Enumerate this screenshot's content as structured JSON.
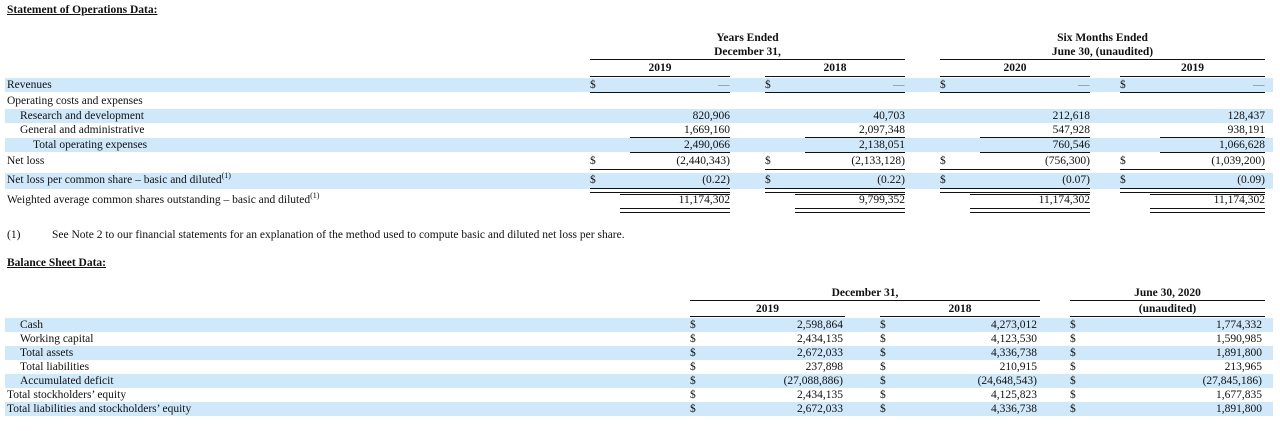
{
  "ops": {
    "title": "Statement of Operations Data:",
    "group1": "Years Ended\nDecember 31,",
    "group2": "Six Months Ended\nJune 30, (unaudited)",
    "cols": [
      "2019",
      "2018",
      "2020",
      "2019"
    ],
    "currency": "$",
    "dash": "—",
    "rows": [
      {
        "label": "Revenues",
        "indent": 0,
        "dollar": true,
        "values": [
          "—",
          "—",
          "—",
          "—"
        ],
        "band": true
      },
      {
        "label": "Operating costs and expenses",
        "indent": 0,
        "dollar": false,
        "values": [
          "",
          "",
          "",
          ""
        ],
        "band": false
      },
      {
        "label": "Research and development",
        "indent": 1,
        "dollar": false,
        "values": [
          "820,906",
          "40,703",
          "212,618",
          "128,437"
        ],
        "band": true
      },
      {
        "label": "General and administrative",
        "indent": 1,
        "dollar": false,
        "values": [
          "1,669,160",
          "2,097,348",
          "547,928",
          "938,191"
        ],
        "band": false
      },
      {
        "label": "Total operating expenses",
        "indent": 2,
        "dollar": false,
        "values": [
          "2,490,066",
          "2,138,051",
          "760,546",
          "1,066,628"
        ],
        "band": true
      },
      {
        "label": "Net loss",
        "indent": 0,
        "dollar": true,
        "values": [
          "(2,440,343)",
          "(2,133,128)",
          "(756,300)",
          "(1,039,200)"
        ],
        "band": false
      },
      {
        "label": "Net loss per common share – basic and diluted",
        "sup": "(1)",
        "indent": 0,
        "dollar": true,
        "values": [
          "(0.22)",
          "(0.22)",
          "(0.07)",
          "(0.09)"
        ],
        "band": true
      },
      {
        "label": "Weighted average common shares outstanding – basic and diluted",
        "sup": "(1)",
        "indent": 0,
        "dollar": false,
        "values": [
          "11,174,302",
          "9,799,352",
          "11,174,302",
          "11,174,302"
        ],
        "band": false
      }
    ],
    "footnote_mark": "(1)",
    "footnote_text": "See Note 2 to our financial statements for an explanation of the method used to compute basic and diluted net loss per share."
  },
  "bs": {
    "title": "Balance Sheet Data:",
    "group1": "December 31,",
    "group2": "June 30, 2020",
    "group2_sub": "(unaudited)",
    "cols": [
      "2019",
      "2018"
    ],
    "currency": "$",
    "rows": [
      {
        "label": "Cash",
        "indent": 1,
        "values": [
          "2,598,864",
          "4,273,012",
          "1,774,332"
        ],
        "band": true
      },
      {
        "label": "Working capital",
        "indent": 1,
        "values": [
          "2,434,135",
          "4,123,530",
          "1,590,985"
        ],
        "band": false
      },
      {
        "label": "Total assets",
        "indent": 1,
        "values": [
          "2,672,033",
          "4,336,738",
          "1,891,800"
        ],
        "band": true
      },
      {
        "label": "Total liabilities",
        "indent": 1,
        "values": [
          "237,898",
          "210,915",
          "213,965"
        ],
        "band": false
      },
      {
        "label": "Accumulated deficit",
        "indent": 1,
        "values": [
          "(27,088,886)",
          "(24,648,543)",
          "(27,845,186)"
        ],
        "band": true
      },
      {
        "label": "Total stockholders’ equity",
        "indent": 0,
        "values": [
          "2,434,135",
          "4,125,823",
          "1,677,835"
        ],
        "band": false
      },
      {
        "label": "Total liabilities and stockholders’ equity",
        "indent": 0,
        "values": [
          "2,672,033",
          "4,336,738",
          "1,891,800"
        ],
        "band": true
      }
    ]
  }
}
